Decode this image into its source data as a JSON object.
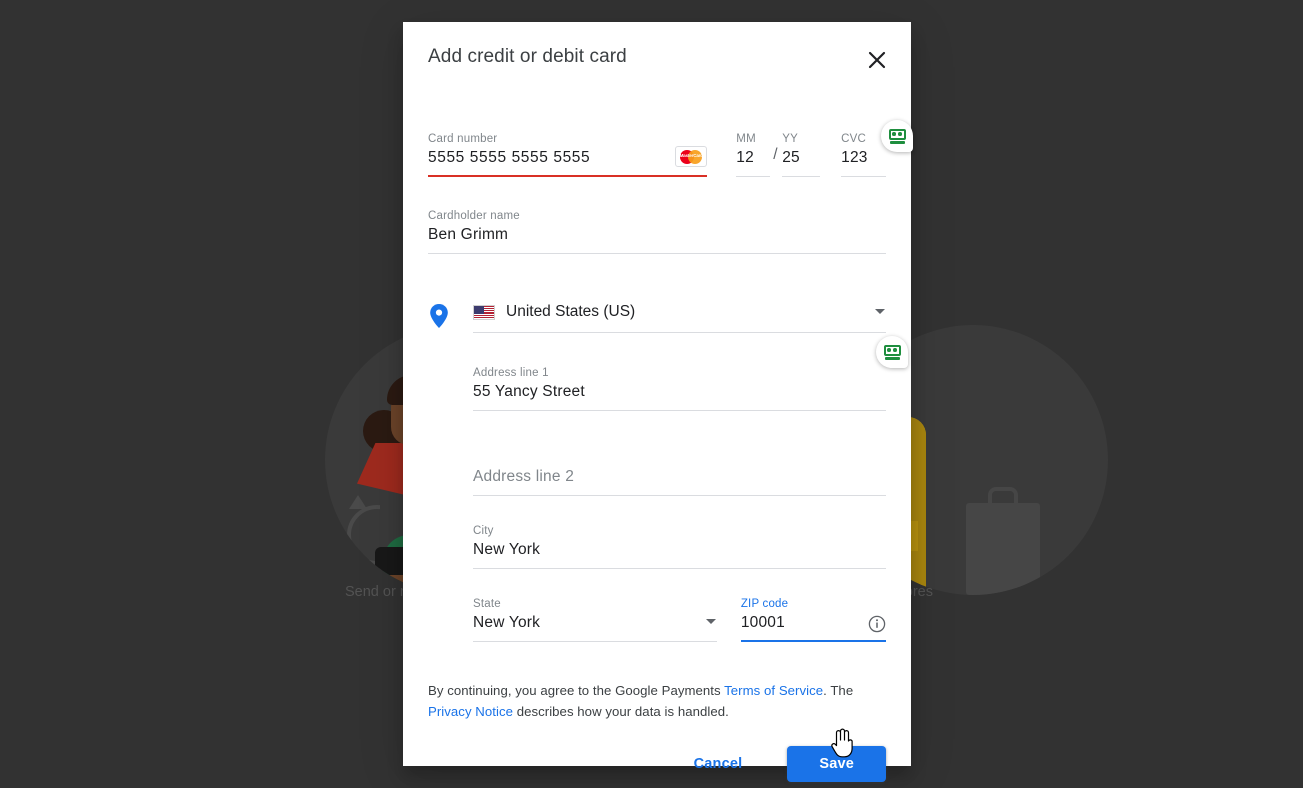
{
  "background": {
    "caption_left": "Send or r",
    "caption_right": "ne in stores",
    "overlay_color": "#323232"
  },
  "dialog": {
    "title": "Add credit or debit card",
    "close_label": "✕",
    "card": {
      "number_label": "Card number",
      "number_value": "5555  5555  5555  5555",
      "number_state": "error",
      "brand": "mastercard",
      "brand_text": "MasterCard",
      "mm_label": "MM",
      "mm_value": "12",
      "separator": "/",
      "yy_label": "YY",
      "yy_value": "25",
      "cvc_label": "CVC",
      "cvc_value": "123",
      "cardholder_label": "Cardholder name",
      "cardholder_value": "Ben Grimm"
    },
    "address": {
      "country_value": "United States (US)",
      "line1_label": "Address line 1",
      "line1_value": "55 Yancy Street",
      "line2_label": "Address line 2",
      "line2_value": "",
      "line2_placeholder": "Address line 2",
      "city_label": "City",
      "city_value": "New York",
      "state_label": "State",
      "state_value": "New York",
      "zip_label": "ZIP code",
      "zip_value": "10001",
      "zip_focused": true
    },
    "legal": {
      "part1": "By continuing, you agree to the Google Payments ",
      "link1": "Terms of Service",
      "part2": ". The ",
      "link2": "Privacy Notice",
      "part3": " describes how your data is handled."
    },
    "actions": {
      "cancel_label": "Cancel",
      "save_label": "Save"
    }
  },
  "colors": {
    "accent": "#1a73e8",
    "error": "#d93025",
    "autofill_green": "#1e8e3e",
    "label_grey": "#80868b"
  }
}
